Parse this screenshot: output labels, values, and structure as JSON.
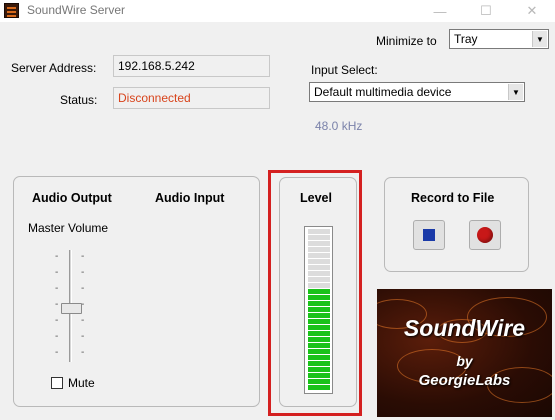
{
  "window": {
    "title": "SoundWire Server"
  },
  "minimize": {
    "label": "Minimize to",
    "value": "Tray"
  },
  "server": {
    "address_label": "Server Address:",
    "address_value": "192.168.5.242",
    "status_label": "Status:",
    "status_value": "Disconnected"
  },
  "input": {
    "label": "Input Select:",
    "value": "Default multimedia device",
    "sample_rate": "48.0 kHz"
  },
  "audio_panel": {
    "output_heading": "Audio Output",
    "input_heading": "Audio Input",
    "master_volume_label": "Master Volume",
    "mute_label": "Mute",
    "mute_checked": false
  },
  "level_panel": {
    "heading": "Level",
    "level_fraction": 0.62
  },
  "record_panel": {
    "heading": "Record to File"
  },
  "logo": {
    "line1": "SoundWire",
    "line2": "by",
    "line3": "GeorgieLabs"
  },
  "colors": {
    "status_disconnected": "#d8441c",
    "sample_rate": "#7a82aa",
    "meter_on": "#19c219",
    "meter_off": "#dcdcdc",
    "highlight": "#d42020",
    "stop": "#1a3aa8",
    "record": "#c81818"
  },
  "icons": [
    "soundwire-app-icon",
    "minimize-icon",
    "maximize-icon",
    "close-icon",
    "stop-icon",
    "record-icon"
  ]
}
